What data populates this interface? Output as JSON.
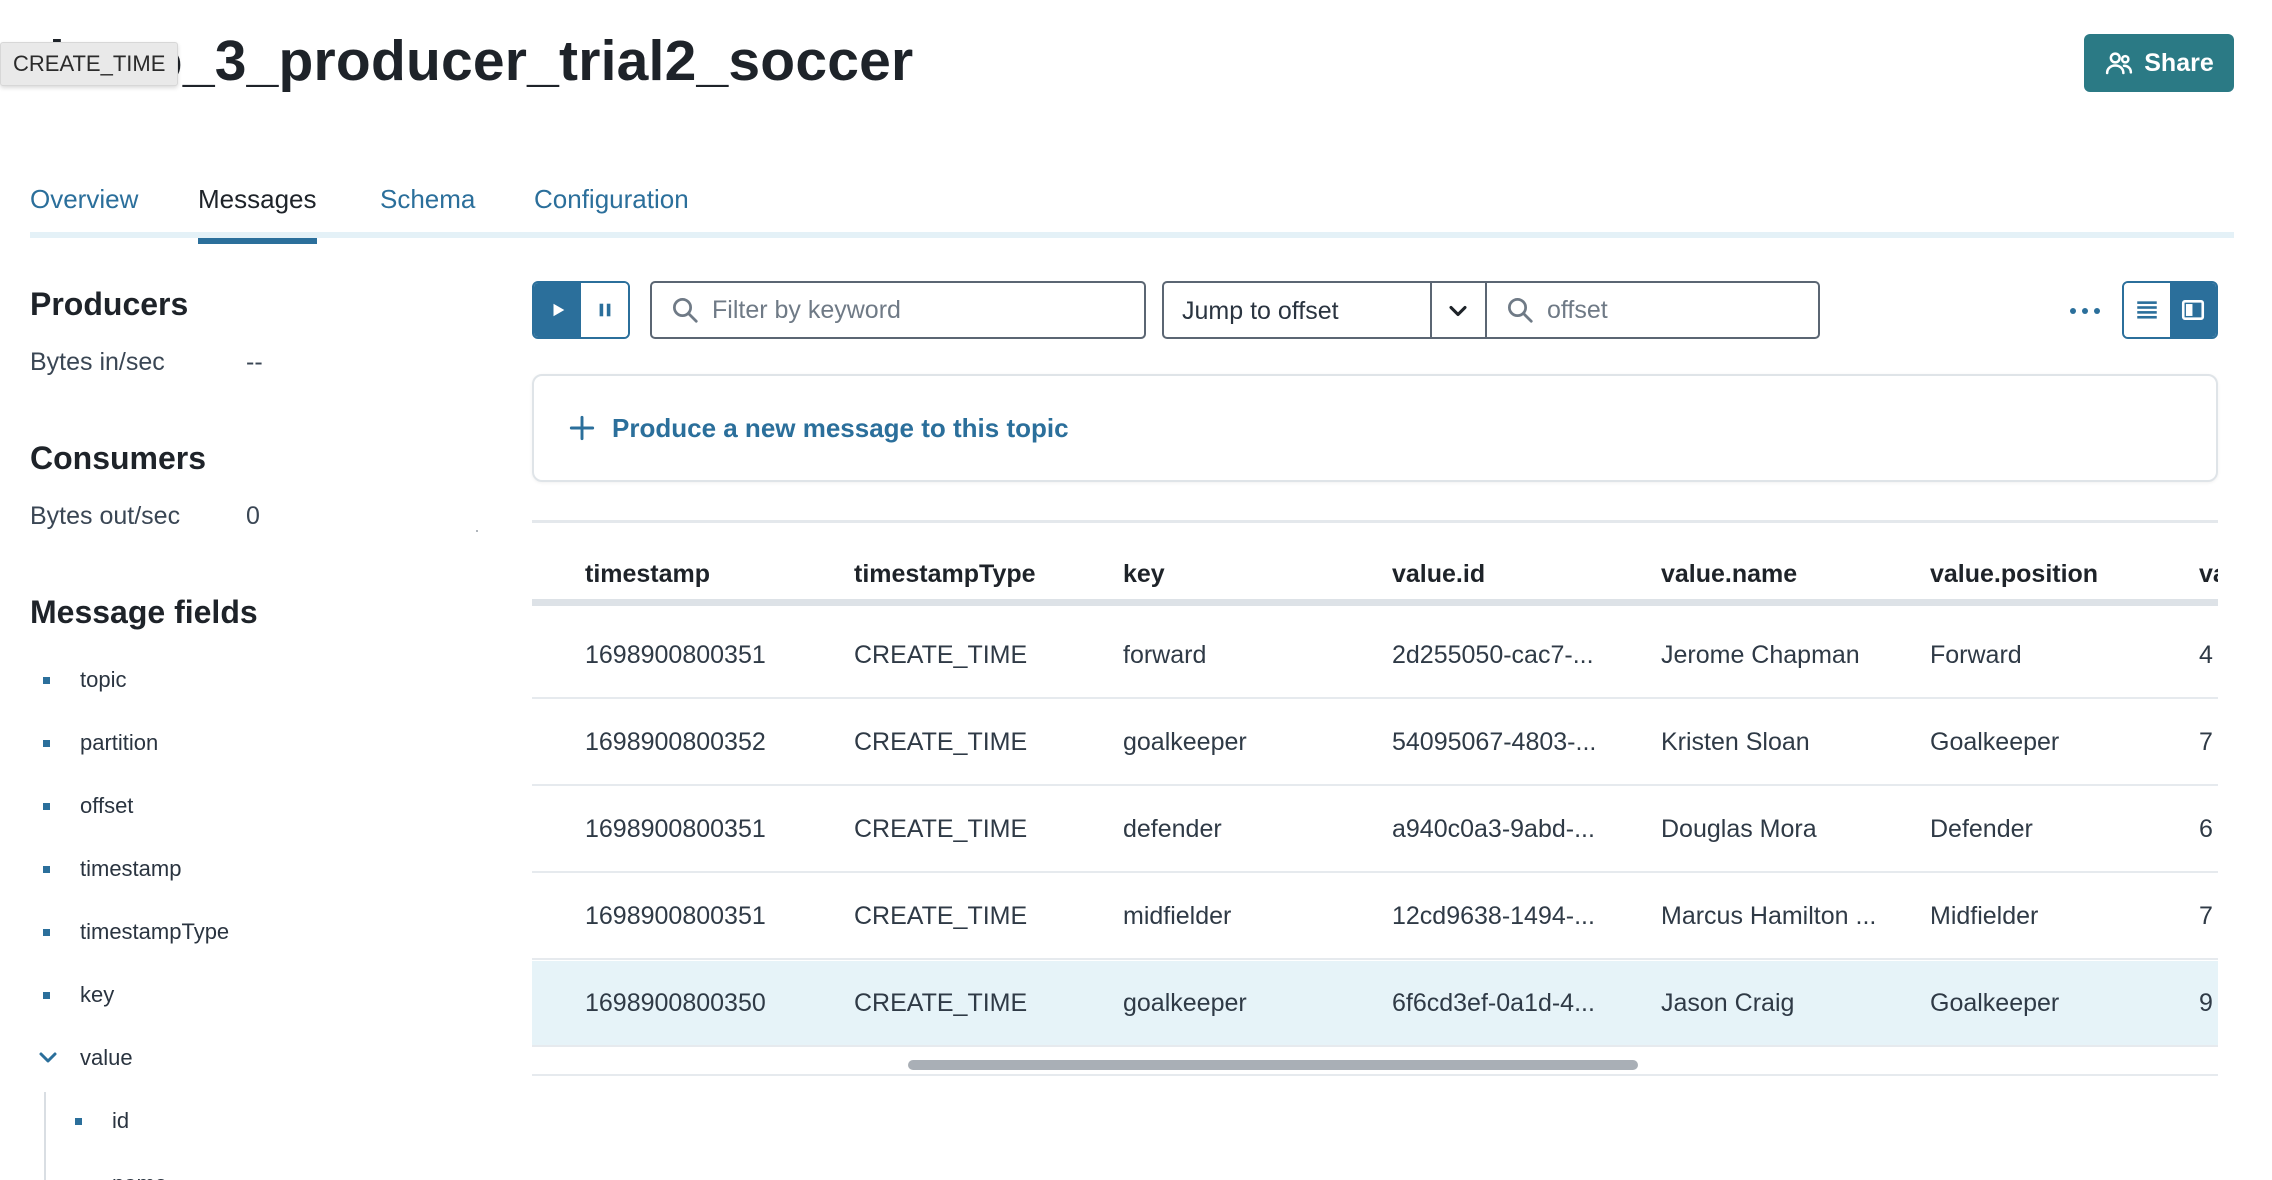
{
  "header": {
    "title": "demo_3_producer_trial2_soccer",
    "tooltip": "CREATE_TIME",
    "share_label": "Share"
  },
  "tabs": [
    {
      "label": "Overview"
    },
    {
      "label": "Messages"
    },
    {
      "label": "Schema"
    },
    {
      "label": "Configuration"
    }
  ],
  "active_tab": "Messages",
  "sidebar": {
    "producers": {
      "heading": "Producers",
      "label": "Bytes in/sec",
      "value": "--"
    },
    "consumers": {
      "heading": "Consumers",
      "label": "Bytes out/sec",
      "value": "0"
    },
    "fields_heading": "Message fields",
    "fields": [
      "topic",
      "partition",
      "offset",
      "timestamp",
      "timestampType",
      "key"
    ],
    "value_field": "value",
    "value_subfields": [
      "id",
      "name"
    ]
  },
  "toolbar": {
    "filter_placeholder": "Filter by keyword",
    "jump_label": "Jump to offset",
    "offset_placeholder": "offset"
  },
  "produce": {
    "label": "Produce a new message to this topic"
  },
  "table": {
    "columns": [
      "timestamp",
      "timestampType",
      "key",
      "value.id",
      "value.name",
      "value.position",
      "va"
    ],
    "rows": [
      [
        "1698900800351",
        "CREATE_TIME",
        "forward",
        "2d255050-cac7-...",
        "Jerome Chapman",
        "Forward",
        "4"
      ],
      [
        "1698900800352",
        "CREATE_TIME",
        "goalkeeper",
        "54095067-4803-...",
        "Kristen Sloan",
        "Goalkeeper",
        "7"
      ],
      [
        "1698900800351",
        "CREATE_TIME",
        "defender",
        "a940c0a3-9abd-...",
        "Douglas Mora",
        "Defender",
        "6"
      ],
      [
        "1698900800351",
        "CREATE_TIME",
        "midfielder",
        "12cd9638-1494-...",
        "Marcus Hamilton ...",
        "Midfielder",
        "7"
      ],
      [
        "1698900800350",
        "CREATE_TIME",
        "goalkeeper",
        "6f6cd3ef-0a1d-4...",
        "Jason Craig",
        "Goalkeeper",
        "9"
      ]
    ],
    "selected_row": 4
  },
  "colors": {
    "accent": "#2b6f9b",
    "share_button": "#2b7a85",
    "selected_row": "#e6f3f8",
    "tab_underline": "#e4f1f7"
  }
}
